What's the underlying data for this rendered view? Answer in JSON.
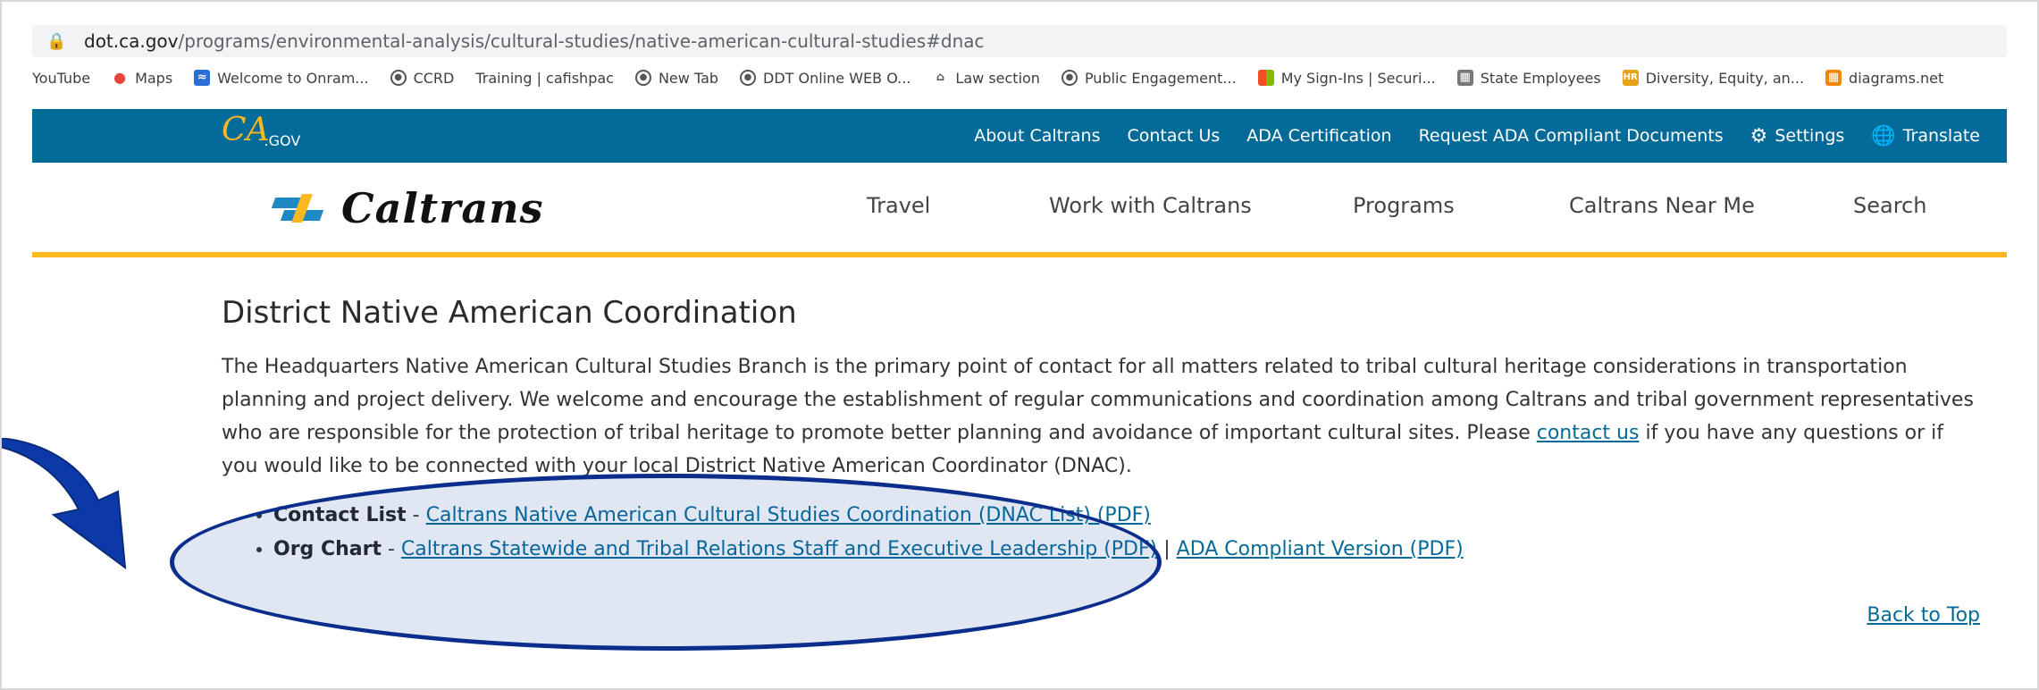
{
  "browser": {
    "url_host": "dot.ca.gov",
    "url_path": "/programs/environmental-analysis/cultural-studies/native-american-cultural-studies#dnac",
    "bookmarks": [
      {
        "label": "YouTube",
        "icon": "none"
      },
      {
        "label": "Maps",
        "icon": "maps-pin-icon"
      },
      {
        "label": "Welcome to Onram...",
        "icon": "onramp-icon"
      },
      {
        "label": "CCRD",
        "icon": "globe-icon"
      },
      {
        "label": "Training | cafishpac",
        "icon": "none"
      },
      {
        "label": "New Tab",
        "icon": "globe-icon"
      },
      {
        "label": "DDT Online WEB O...",
        "icon": "globe-icon"
      },
      {
        "label": "Law section",
        "icon": "law-icon"
      },
      {
        "label": "Public Engagement...",
        "icon": "globe-icon"
      },
      {
        "label": "My Sign-Ins | Securi...",
        "icon": "microsoft-icon"
      },
      {
        "label": "State Employees",
        "icon": "building-icon"
      },
      {
        "label": "Diversity, Equity, an...",
        "icon": "hr-icon"
      },
      {
        "label": "diagrams.net",
        "icon": "drawio-icon"
      }
    ]
  },
  "header": {
    "cagov_logo": "CA",
    "cagov_suffix": ".GOV",
    "utility_links": {
      "about": "About Caltrans",
      "contact": "Contact Us",
      "ada_cert": "ADA Certification",
      "request_ada": "Request ADA Compliant Documents",
      "settings": "Settings",
      "translate": "Translate"
    },
    "logo_text": "Caltrans",
    "main_nav": {
      "travel": "Travel",
      "work": "Work with Caltrans",
      "programs": "Programs",
      "near_me": "Caltrans Near Me",
      "search": "Search"
    }
  },
  "main": {
    "title": "District Native American Coordination",
    "para_before_link": "The Headquarters Native American Cultural Studies Branch is the primary point of contact for all matters related to tribal cultural heritage considerations in transportation planning and project delivery.  We welcome and encourage the establishment of regular communications and coordination among Caltrans and tribal government representatives who are responsible for the protection of tribal heritage to promote better planning and avoidance of important cultural sites.  Please ",
    "para_link": "contact us",
    "para_after_link": " if you have any questions or if you would like to be connected with your local District Native American Coordinator (DNAC).",
    "list": {
      "item1_label": "Contact List",
      "item1_sep": " - ",
      "item1_link": "Caltrans Native American Cultural Studies Coordination (DNAC List) (PDF)",
      "item2_label": "Org Chart",
      "item2_sep": " - ",
      "item2_link1": "Caltrans Statewide and Tribal Relations Staff and Executive Leadership (PDF)",
      "item2_divider": " | ",
      "item2_link2": "ADA Compliant Version (PDF)"
    },
    "back_to_top": "Back to Top"
  },
  "colors": {
    "topbar": "#046b99",
    "accent_gold": "#fdb81e",
    "annotation": "#0b2e8c"
  }
}
